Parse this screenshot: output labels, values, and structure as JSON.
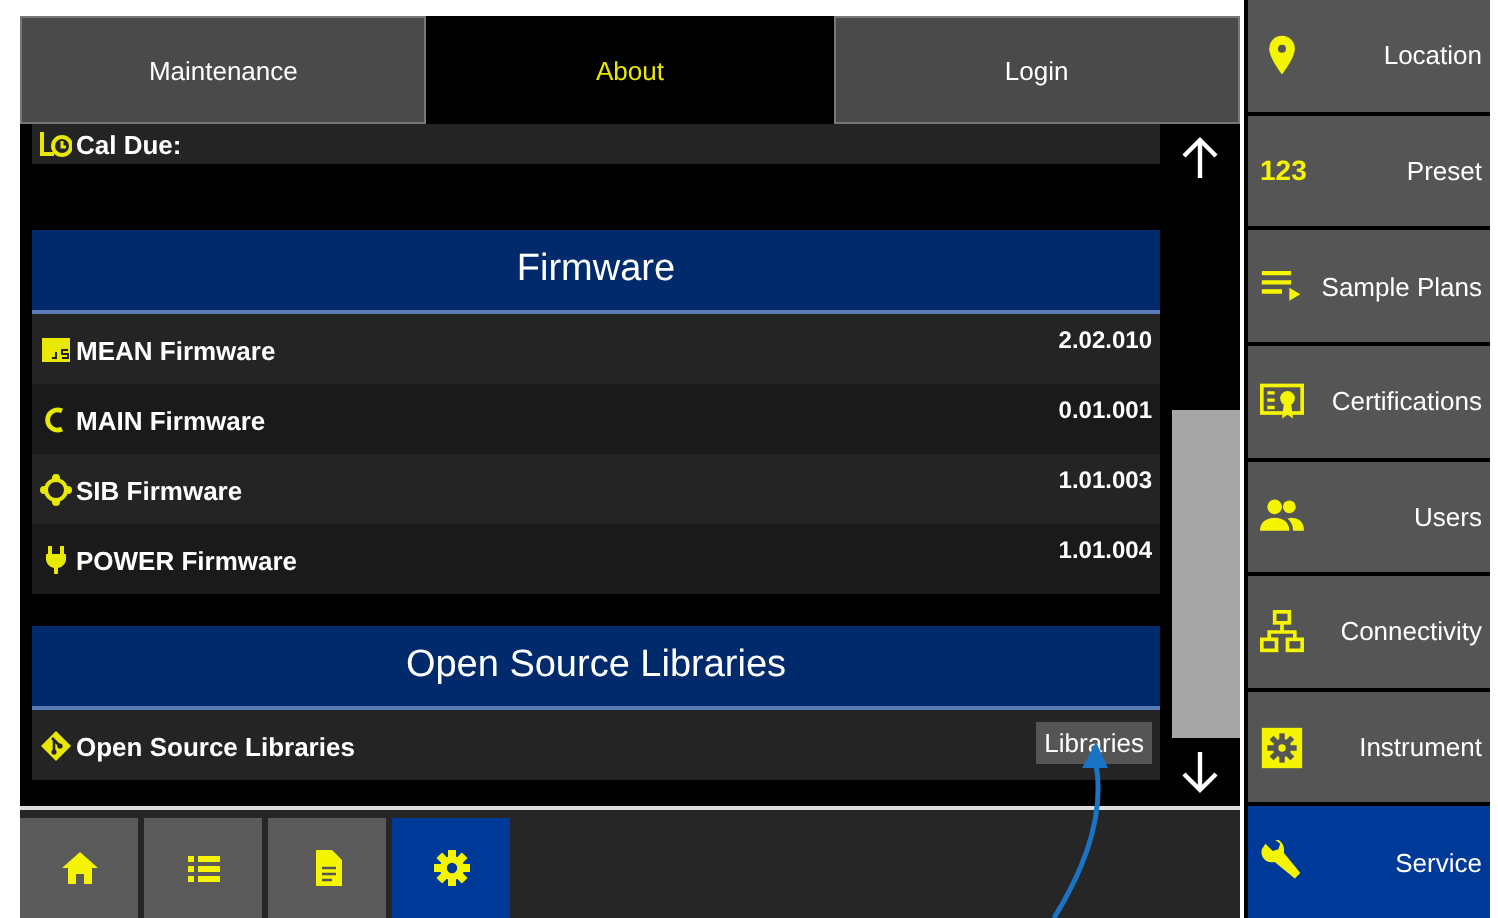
{
  "tabs": [
    {
      "label": "Maintenance",
      "selected": false
    },
    {
      "label": "About",
      "selected": true
    },
    {
      "label": "Login",
      "selected": false
    }
  ],
  "top_row": {
    "label": "Cal Due:"
  },
  "sections": [
    {
      "title": "Firmware",
      "rows": [
        {
          "label": "MEAN Firmware",
          "value": "2.02.010"
        },
        {
          "label": "MAIN Firmware",
          "value": "0.01.001"
        },
        {
          "label": "SIB Firmware",
          "value": "1.01.003"
        },
        {
          "label": "POWER Firmware",
          "value": "1.01.004"
        }
      ]
    },
    {
      "title": "Open Source Libraries",
      "rows": [
        {
          "label": "Open Source Libraries",
          "button": "Libraries"
        }
      ]
    }
  ],
  "bottom_nav": [
    {
      "selected": false
    },
    {
      "selected": false
    },
    {
      "selected": false
    },
    {
      "selected": true
    }
  ],
  "sidebar": [
    {
      "label": "Location",
      "selected": false
    },
    {
      "icon_text": "123",
      "label": "Preset",
      "selected": false
    },
    {
      "label": "Sample Plans",
      "selected": false
    },
    {
      "label": "Certifications",
      "selected": false
    },
    {
      "label": "Users",
      "selected": false
    },
    {
      "label": "Connectivity",
      "selected": false
    },
    {
      "label": "Instrument",
      "selected": false
    },
    {
      "label": "Service",
      "selected": true
    }
  ]
}
